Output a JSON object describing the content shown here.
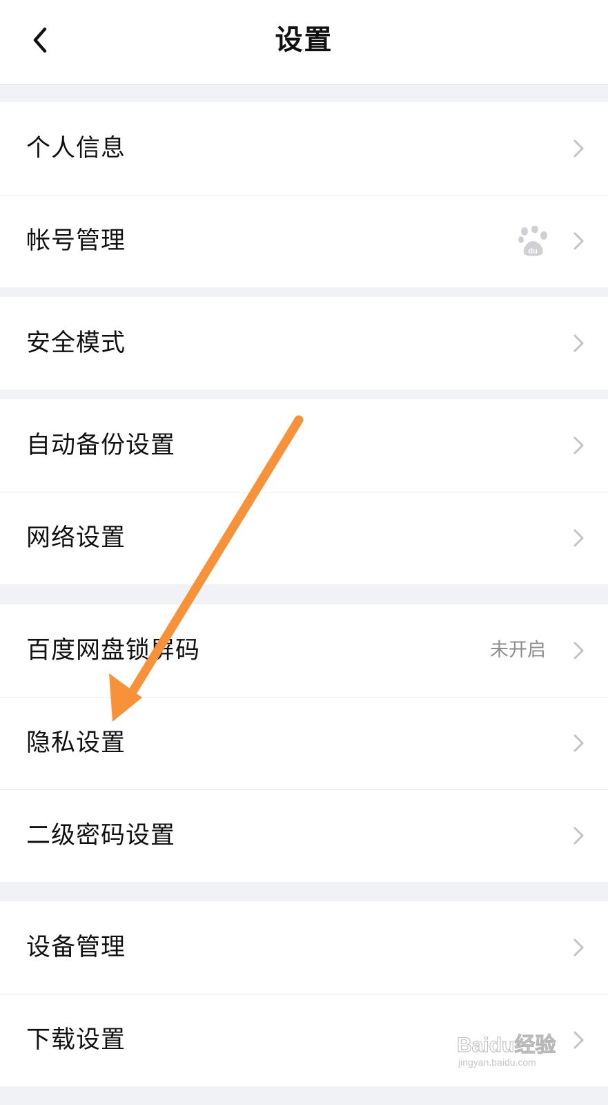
{
  "header": {
    "title": "设置",
    "back_icon": "chevron-left-icon"
  },
  "sections": [
    {
      "items": [
        {
          "label": "个人信息",
          "value": ""
        },
        {
          "label": "帐号管理",
          "value": "",
          "icon": "baidu-paw-icon"
        }
      ]
    },
    {
      "items": [
        {
          "label": "安全模式",
          "value": ""
        }
      ]
    },
    {
      "items": [
        {
          "label": "自动备份设置",
          "value": ""
        },
        {
          "label": "网络设置",
          "value": ""
        }
      ]
    },
    {
      "items": [
        {
          "label": "百度网盘锁屏码",
          "value": "未开启"
        },
        {
          "label": "隐私设置",
          "value": ""
        },
        {
          "label": "二级密码设置",
          "value": ""
        }
      ]
    },
    {
      "items": [
        {
          "label": "设备管理",
          "value": ""
        },
        {
          "label": "下载设置",
          "value": ""
        }
      ]
    }
  ],
  "annotation": {
    "arrow_color": "#f7923a"
  },
  "watermark": {
    "brand": "Baidu经验",
    "url": "jingyan.baidu.com"
  },
  "colors": {
    "background": "#f1f2f5",
    "surface": "#ffffff",
    "chevron": "#c2c2c7",
    "secondary_text": "#8c8c8c"
  }
}
